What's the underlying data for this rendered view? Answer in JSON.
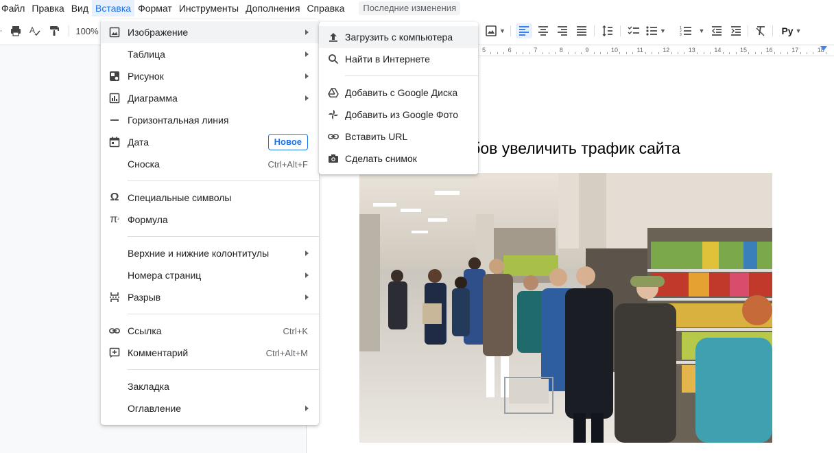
{
  "menubar": {
    "items": [
      "Файл",
      "Правка",
      "Вид",
      "Вставка",
      "Формат",
      "Инструменты",
      "Дополнения",
      "Справка"
    ],
    "last_edit": "Последние изменения"
  },
  "toolbar": {
    "zoom": "100%",
    "style_label": "Py"
  },
  "ruler": {
    "numbers": [
      "5",
      "6",
      "7",
      "8",
      "9",
      "10",
      "11",
      "12",
      "13",
      "14",
      "15",
      "16",
      "17",
      "18"
    ]
  },
  "document": {
    "title_visible": "х способов увеличить трафик сайта"
  },
  "insert_menu": {
    "image": "Изображение",
    "table": "Таблица",
    "drawing": "Рисунок",
    "chart": "Диаграмма",
    "hline": "Горизонтальная линия",
    "date": "Дата",
    "date_badge": "Новое",
    "footnote": "Сноска",
    "footnote_shortcut": "Ctrl+Alt+F",
    "special_chars": "Специальные символы",
    "equation": "Формула",
    "headers_footers": "Верхние и нижние колонтитулы",
    "page_numbers": "Номера страниц",
    "break": "Разрыв",
    "link": "Ссылка",
    "link_shortcut": "Ctrl+K",
    "comment": "Комментарий",
    "comment_shortcut": "Ctrl+Alt+M",
    "bookmark": "Закладка",
    "toc": "Оглавление"
  },
  "image_submenu": {
    "upload": "Загрузить с компьютера",
    "search_web": "Найти в Интернете",
    "drive": "Добавить с Google Диска",
    "photos": "Добавить из Google Фото",
    "by_url": "Вставить URL",
    "camera": "Сделать снимок"
  },
  "colors": {
    "accent": "#1a73e8",
    "menu_highlight": "#f1f3f4"
  }
}
